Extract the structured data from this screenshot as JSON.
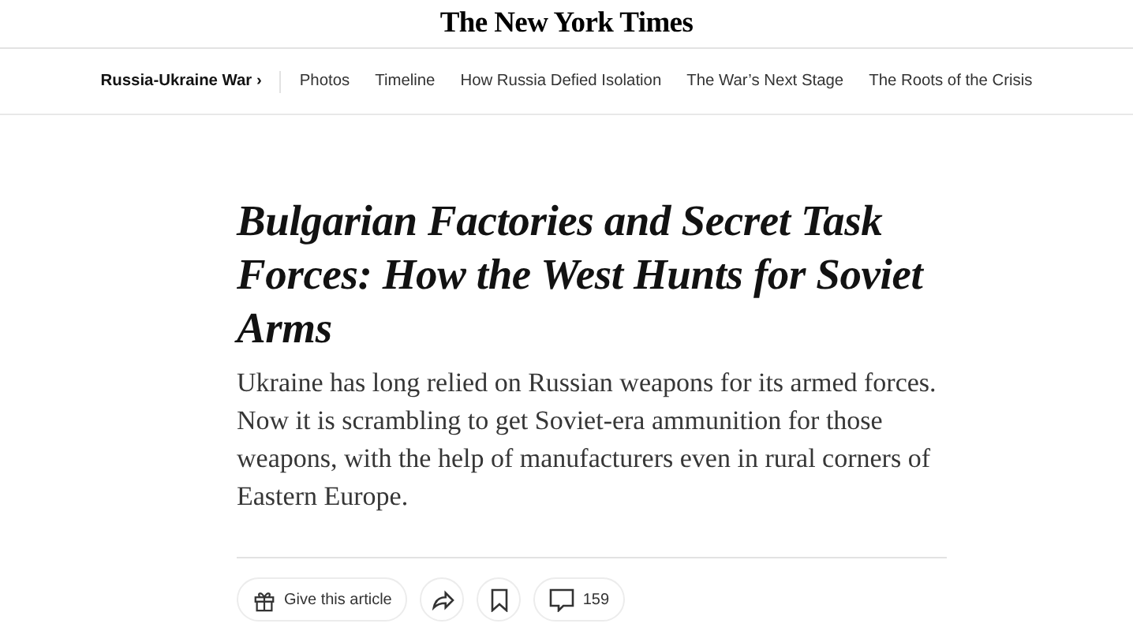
{
  "masthead": {
    "logo": "The New York Times"
  },
  "nav": {
    "section": "Russia-Ukraine War",
    "section_arrow": "›",
    "links": [
      "Photos",
      "Timeline",
      "How Russia Defied Isolation",
      "The War’s Next Stage",
      "The Roots of the Crisis"
    ]
  },
  "article": {
    "headline": "Bulgarian Factories and Secret Task Forces: How the West Hunts for Soviet Arms",
    "summary": "Ukraine has long relied on Russian weapons for its armed forces. Now it is scrambling to get Soviet-era ammunition for those weapons, with the help of manufacturers even in rural corners of Eastern Europe."
  },
  "toolbar": {
    "gift_label": "Give this article",
    "comment_count": "159"
  }
}
